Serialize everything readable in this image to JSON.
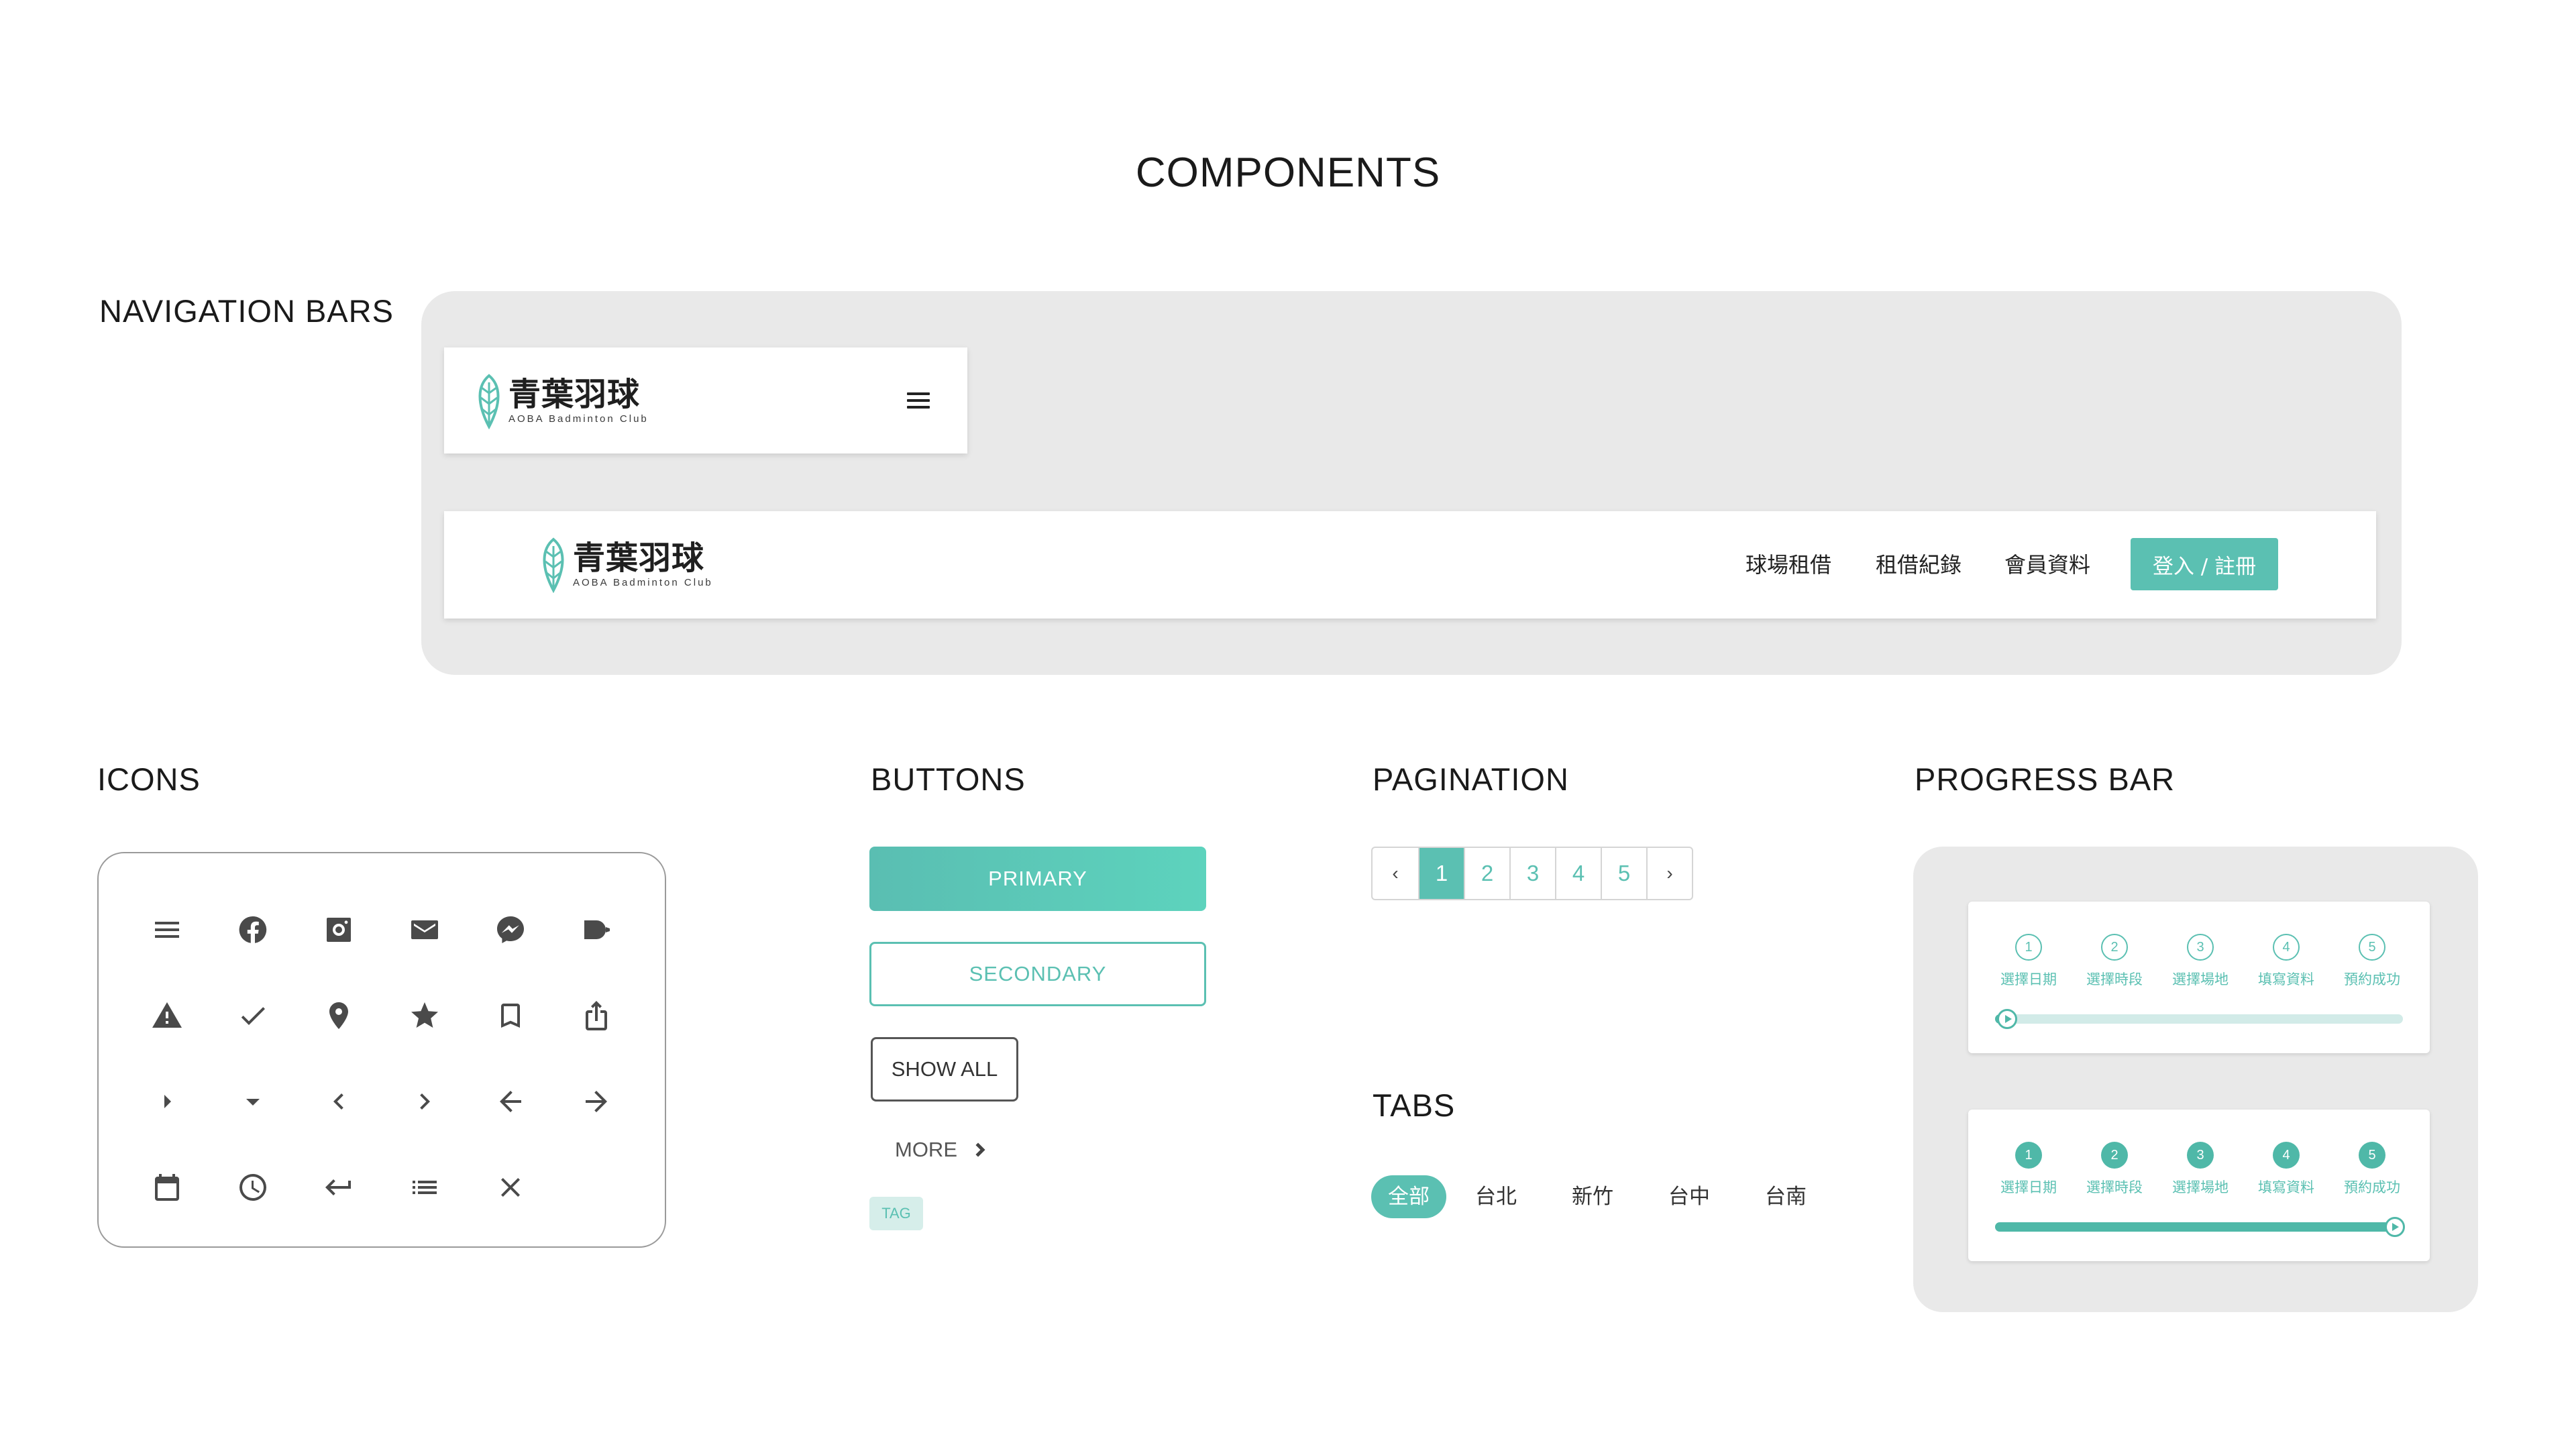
{
  "page": {
    "title": "COMPONENTS"
  },
  "sections": {
    "navigation": "NAVIGATION BARS",
    "icons": "ICONS",
    "buttons": "BUTTONS",
    "pagination": "PAGINATION",
    "tabs": "TABS",
    "progress": "PROGRESS BAR"
  },
  "brand": {
    "name_cn": "青葉羽球",
    "name_en": "AOBA Badminton Club",
    "accent_color": "#5bc0b2"
  },
  "nav_desktop": {
    "links": [
      "球場租借",
      "租借紀錄",
      "會員資料"
    ],
    "login_label": "登入 / 註冊"
  },
  "icons": [
    "menu-icon",
    "facebook-icon",
    "instagram-icon",
    "mail-icon",
    "messenger-icon",
    "video-icon",
    "warning-icon",
    "check-icon",
    "location-pin-icon",
    "star-icon",
    "bookmark-icon",
    "share-icon",
    "caret-right-icon",
    "caret-down-icon",
    "chevron-left-icon",
    "chevron-right-icon",
    "arrow-left-icon",
    "arrow-right-icon",
    "calendar-icon",
    "clock-icon",
    "return-icon",
    "list-icon",
    "close-icon"
  ],
  "buttons": {
    "primary": "PRIMARY",
    "secondary": "SECONDARY",
    "show_all": "SHOW ALL",
    "more": "MORE",
    "tag": "TAG"
  },
  "pagination": {
    "prev": "‹",
    "next": "›",
    "pages": [
      "1",
      "2",
      "3",
      "4",
      "5"
    ],
    "current": "1"
  },
  "tabs": {
    "items": [
      "全部",
      "台北",
      "新竹",
      "台中",
      "台南"
    ],
    "active": "全部"
  },
  "progress": {
    "steps": [
      {
        "num": "1",
        "label": "選擇日期"
      },
      {
        "num": "2",
        "label": "選擇時段"
      },
      {
        "num": "3",
        "label": "選擇場地"
      },
      {
        "num": "4",
        "label": "填寫資料"
      },
      {
        "num": "5",
        "label": "預約成功"
      }
    ],
    "bar1_progress": 0.03,
    "bar2_progress": 0.98
  }
}
